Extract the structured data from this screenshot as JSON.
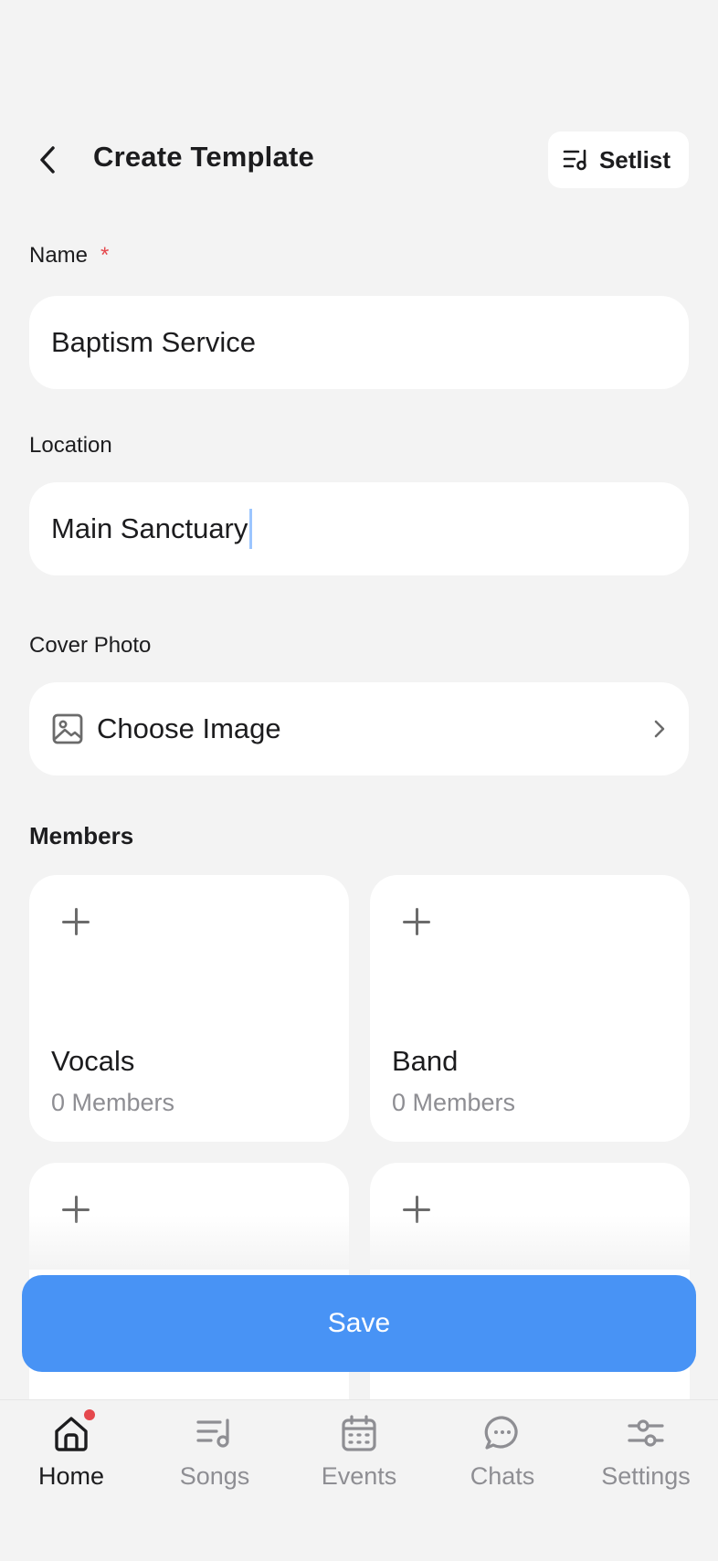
{
  "header": {
    "title": "Create Template",
    "setlist_label": "Setlist"
  },
  "form": {
    "name_label": "Name",
    "required_mark": "*",
    "name_value": "Baptism Service",
    "location_label": "Location",
    "location_value": "Main Sanctuary",
    "cover_label": "Cover Photo",
    "cover_action": "Choose Image"
  },
  "members": {
    "title": "Members",
    "groups": [
      {
        "name": "Vocals",
        "count": "0 Members"
      },
      {
        "name": "Band",
        "count": "0 Members"
      }
    ]
  },
  "save_label": "Save",
  "nav": {
    "items": [
      {
        "label": "Home",
        "icon": "home-icon",
        "active": true
      },
      {
        "label": "Songs",
        "icon": "songs-icon",
        "active": false
      },
      {
        "label": "Events",
        "icon": "calendar-icon",
        "active": false
      },
      {
        "label": "Chats",
        "icon": "chat-icon",
        "active": false
      },
      {
        "label": "Settings",
        "icon": "sliders-icon",
        "active": false
      }
    ]
  },
  "colors": {
    "accent": "#4893f5",
    "required": "#e5484d",
    "background": "#f3f3f3"
  }
}
